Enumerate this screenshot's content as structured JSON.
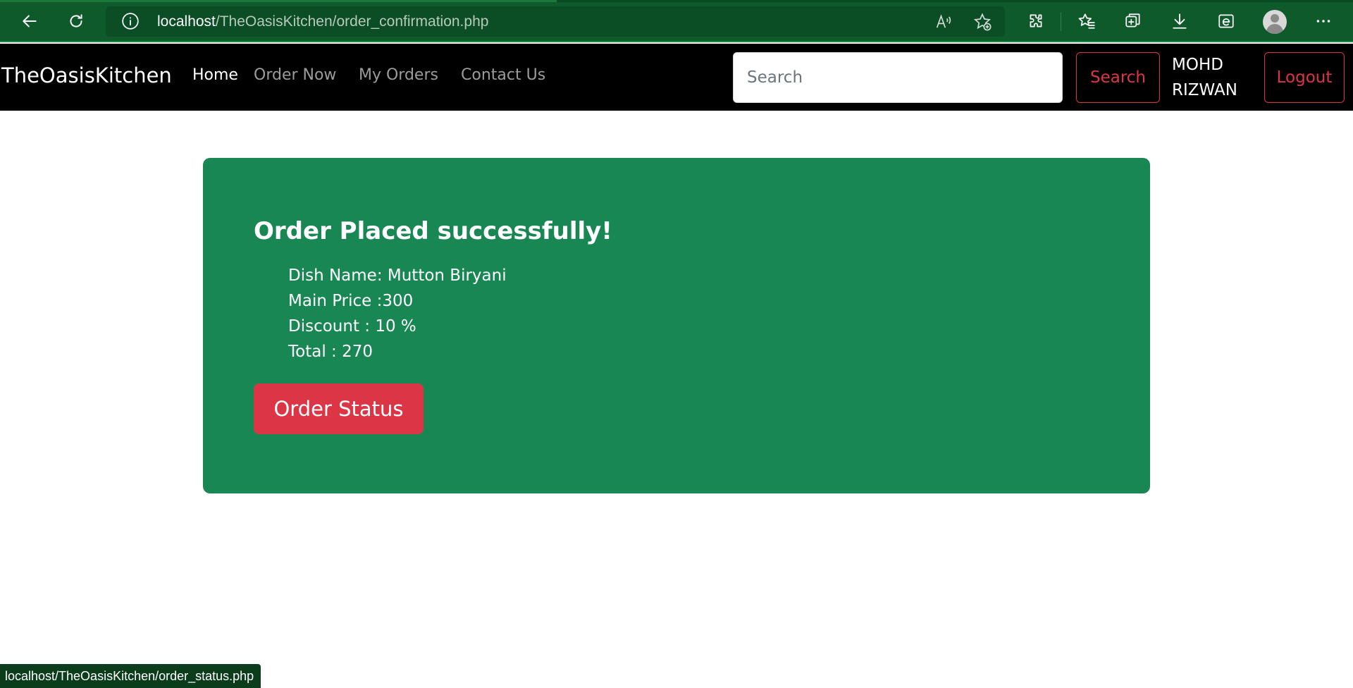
{
  "browser": {
    "url_host": "localhost",
    "url_path": "/TheOasisKitchen/order_confirmation.php",
    "icons": [
      "back-icon",
      "refresh-icon",
      "info-icon",
      "read-aloud-icon",
      "add-favorite-icon",
      "extensions-icon",
      "favorites-icon",
      "collections-icon",
      "downloads-icon",
      "ie-mode-icon",
      "profile-icon",
      "more-icon"
    ],
    "accent": "#0f5a2a"
  },
  "navbar": {
    "brand": "TheOasisKitchen",
    "links": [
      "Home",
      "Order Now",
      "My Orders",
      "Contact Us"
    ],
    "search_placeholder": "Search",
    "search_button": "Search",
    "user_first": "MOHD",
    "user_last": "RIZWAN",
    "logout_button": "Logout"
  },
  "card": {
    "title": "Order Placed successfully!",
    "dish": "Dish Name: Mutton Biryani",
    "price": "Main Price :300",
    "discount": "Discount : 10 %",
    "total": "Total : 270",
    "status_button": "Order Status",
    "color": "#198754"
  },
  "statusbar": {
    "link": "localhost/TheOasisKitchen/order_status.php"
  },
  "colors": {
    "danger": "#dc3545",
    "navbar_bg": "#000000"
  }
}
